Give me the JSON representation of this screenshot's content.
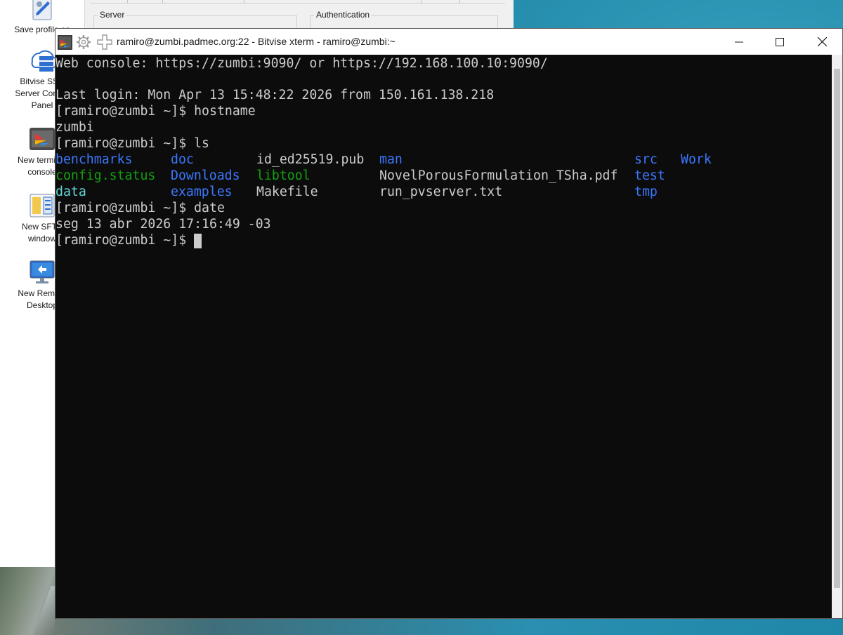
{
  "colors": {
    "terminal_bg": "#0c0c0c",
    "terminal_fg": "#cccccc",
    "dir_blue": "#3b78ff",
    "exec_green": "#13a10e",
    "link_cyan": "#61d6d6"
  },
  "launcher": {
    "items": [
      {
        "label": "Save profile as",
        "icon": "save-profile-icon"
      },
      {
        "label": "Bitvise SSH Server Control Panel",
        "icon": "server-control-icon"
      },
      {
        "label": "New terminal console",
        "icon": "terminal-icon"
      },
      {
        "label": "New SFTP window",
        "icon": "sftp-icon"
      },
      {
        "label": "New Remote Desktop",
        "icon": "remote-desktop-icon"
      }
    ]
  },
  "client_window": {
    "server_group": "Server",
    "auth_group": "Authentication"
  },
  "xterm": {
    "title": "ramiro@zumbi.padmec.org:22 - Bitvise xterm - ramiro@zumbi:~",
    "lines": {
      "web_console": "Web console: https://zumbi:9090/ or https://192.168.100.10:9090/",
      "last_login": "Last login: Mon Apr 13 15:48:22 2026 from 150.161.138.218",
      "cmd_hostname": "[ramiro@zumbi ~]$ hostname",
      "out_hostname": "zumbi",
      "cmd_ls": "[ramiro@zumbi ~]$ ls",
      "cmd_date": "[ramiro@zumbi ~]$ date",
      "out_date": "seg 13 abr 2026 17:16:49 -03",
      "prompt": "[ramiro@zumbi ~]$ "
    },
    "ls_output": [
      {
        "name": "benchmarks",
        "type": "dir"
      },
      {
        "name": "doc",
        "type": "dir"
      },
      {
        "name": "id_ed25519.pub",
        "type": "file"
      },
      {
        "name": "man",
        "type": "dir"
      },
      {
        "name": "src",
        "type": "dir"
      },
      {
        "name": "Work",
        "type": "dir"
      },
      {
        "name": "config.status",
        "type": "exec"
      },
      {
        "name": "Downloads",
        "type": "dir"
      },
      {
        "name": "libtool",
        "type": "exec"
      },
      {
        "name": "NovelPorousFormulation_TSha.pdf",
        "type": "file"
      },
      {
        "name": "test",
        "type": "dir"
      },
      {
        "name": "data",
        "type": "link"
      },
      {
        "name": "examples",
        "type": "dir"
      },
      {
        "name": "Makefile",
        "type": "file"
      },
      {
        "name": "run_pvserver.txt",
        "type": "file"
      },
      {
        "name": "tmp",
        "type": "dir"
      }
    ]
  }
}
